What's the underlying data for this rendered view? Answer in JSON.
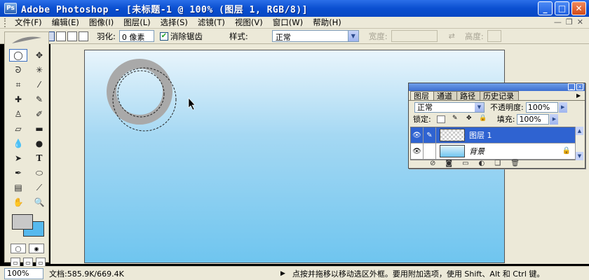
{
  "window": {
    "title": "Adobe Photoshop - [未标题-1 @ 100% (图层 1, RGB/8)]",
    "icon_name": "photoshop-app-icon"
  },
  "menu": {
    "items": [
      {
        "label": "文件(F)"
      },
      {
        "label": "编辑(E)"
      },
      {
        "label": "图像(I)"
      },
      {
        "label": "图层(L)"
      },
      {
        "label": "选择(S)"
      },
      {
        "label": "滤镜(T)"
      },
      {
        "label": "视图(V)"
      },
      {
        "label": "窗口(W)"
      },
      {
        "label": "帮助(H)"
      }
    ]
  },
  "options": {
    "feather_label": "羽化:",
    "feather_value": "0 像素",
    "antialias_label": "消除锯齿",
    "antialias_checked": "✔",
    "style_label": "样式:",
    "style_value": "正常",
    "width_label": "宽度:",
    "height_label": "高度:"
  },
  "colors": {
    "foreground": "#c8c8c8",
    "background": "#56b9ee",
    "selection_accent": "#2f63d1"
  },
  "layers_panel": {
    "tabs": [
      {
        "label": "图层"
      },
      {
        "label": "通道"
      },
      {
        "label": "路径"
      },
      {
        "label": "历史记录"
      }
    ],
    "blend_mode": "正常",
    "opacity_label": "不透明度:",
    "opacity_value": "100%",
    "lock_label": "锁定:",
    "fill_label": "填充:",
    "fill_value": "100%",
    "layers": [
      {
        "name": "图层 1",
        "selected": true
      },
      {
        "name": "背景",
        "locked": true
      }
    ]
  },
  "status": {
    "zoom": "100%",
    "doc_size": "文档:585.9K/669.4K",
    "hint": "点按并拖移以移动选区外框。要用附加选项，使用 Shift、Alt 和 Ctrl 键。"
  }
}
